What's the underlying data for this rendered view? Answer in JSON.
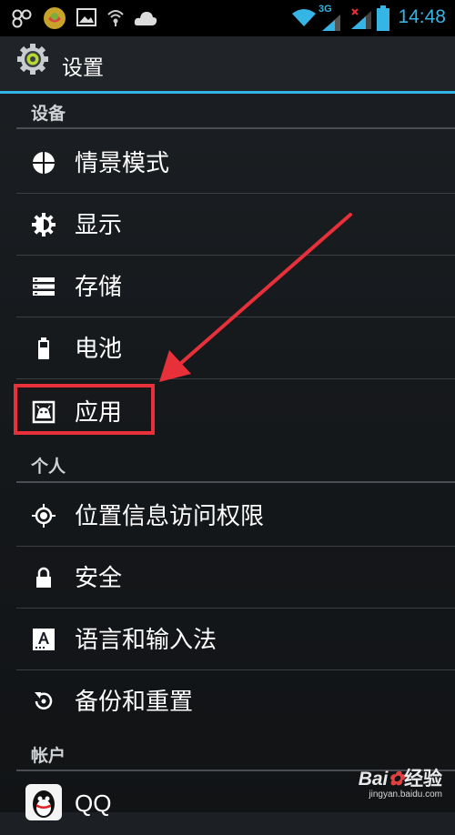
{
  "status_bar": {
    "time": "14:48",
    "network_label": "3G",
    "icons": [
      "sms-icon",
      "weather-icon",
      "image-icon",
      "wifi-signal-icon",
      "cloud-icon",
      "wifi-icon",
      "signal-icon",
      "no-signal-icon",
      "battery-icon"
    ]
  },
  "action_bar": {
    "title": "设置",
    "icon": "settings-gear-icon"
  },
  "sections": [
    {
      "header": "设备",
      "items": [
        {
          "label": "情景模式",
          "icon": "profile-icon"
        },
        {
          "label": "显示",
          "icon": "brightness-icon"
        },
        {
          "label": "存储",
          "icon": "storage-icon"
        },
        {
          "label": "电池",
          "icon": "battery-icon"
        },
        {
          "label": "应用",
          "icon": "apps-icon"
        }
      ]
    },
    {
      "header": "个人",
      "items": [
        {
          "label": "位置信息访问权限",
          "icon": "location-icon"
        },
        {
          "label": "安全",
          "icon": "lock-icon"
        },
        {
          "label": "语言和输入法",
          "icon": "language-icon"
        },
        {
          "label": "备份和重置",
          "icon": "backup-icon"
        }
      ]
    },
    {
      "header": "帐户",
      "items": [
        {
          "label": "QQ",
          "icon": "qq-icon"
        }
      ]
    }
  ],
  "annotation": {
    "highlight_color": "#e8303a",
    "highlighted_item": "应用"
  },
  "watermark": {
    "logo_text_left": "Bai",
    "logo_text_right": "经验",
    "url": "jingyan.baidu.com"
  },
  "colors": {
    "accent": "#33b5e5",
    "annotation_red": "#e8303a"
  }
}
